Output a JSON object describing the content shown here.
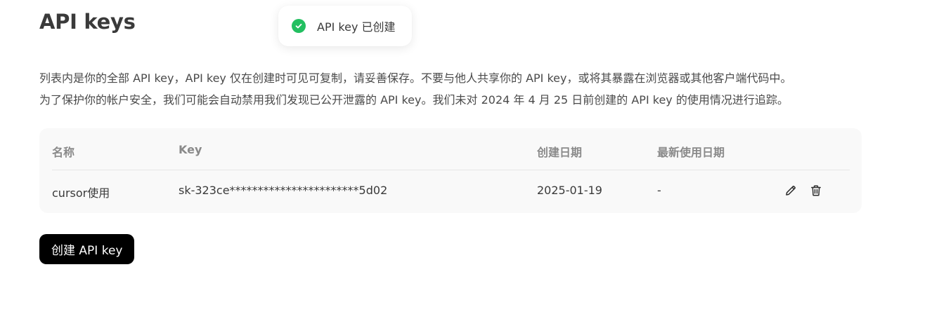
{
  "header": {
    "title": "API keys"
  },
  "toast": {
    "message": "API key 已创建",
    "icon": "check-circle-icon",
    "color": "#22bf60"
  },
  "description": {
    "line1": "列表内是你的全部 API key，API key 仅在创建时可见可复制，请妥善保存。不要与他人共享你的 API key，或将其暴露在浏览器或其他客户端代码中。",
    "line2": "为了保护你的帐户安全，我们可能会自动禁用我们发现已公开泄露的 API key。我们未对 2024 年 4 月 25 日前创建的 API key 的使用情况进行追踪。"
  },
  "table": {
    "columns": [
      "名称",
      "Key",
      "创建日期",
      "最新使用日期"
    ],
    "rows": [
      {
        "name": "cursor使用",
        "key": "sk-323ce***********************5d02",
        "created": "2025-01-19",
        "last_used": "-",
        "actions": [
          "edit-icon",
          "trash-icon"
        ]
      }
    ]
  },
  "actions": {
    "create_label": "创建 API key"
  }
}
